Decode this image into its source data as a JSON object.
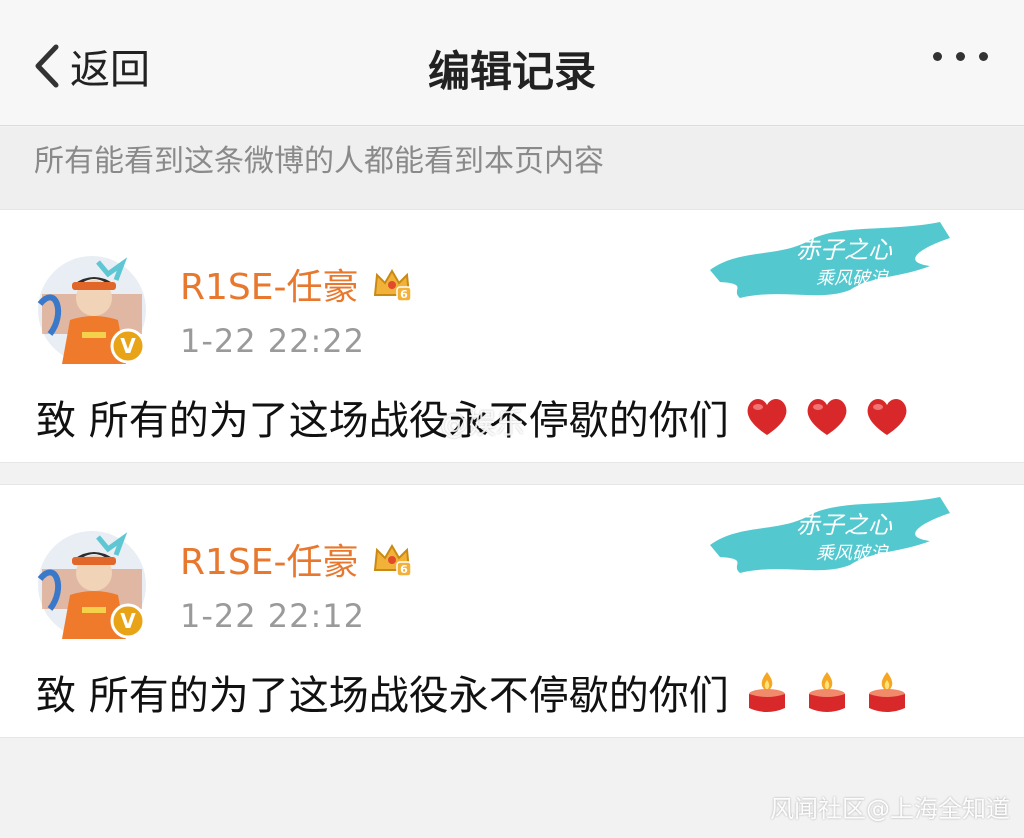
{
  "header": {
    "back_label": "返回",
    "title": "编辑记录"
  },
  "notice": "所有能看到这条微博的人都能看到本页内容",
  "posts": [
    {
      "username": "R1SE-任豪",
      "time": "1-22 22:22",
      "text": "致 所有的为了这场战役永不停歇的你们",
      "emojis": [
        "heart-icon",
        "heart-icon",
        "heart-icon"
      ]
    },
    {
      "username": "R1SE-任豪",
      "time": "1-22 22:12",
      "text": "致 所有的为了这场战役永不停歇的你们",
      "emojis": [
        "candle-icon",
        "candle-icon",
        "candle-icon"
      ]
    }
  ],
  "membership_badge": "6",
  "verified_badge": "V",
  "watermark_mid": "@娱乐",
  "watermark": "风闻社区@上海全知道",
  "colors": {
    "username": "#e8782e",
    "banner": "#53c8cf",
    "heart": "#d9282a",
    "verified": "#e8a317"
  }
}
